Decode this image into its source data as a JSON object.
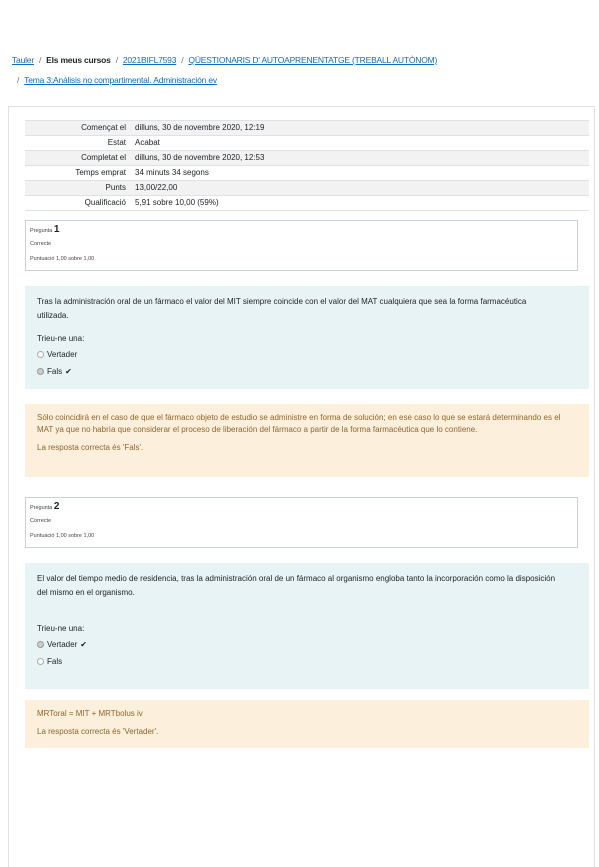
{
  "breadcrumb": {
    "items": [
      "Tauler",
      "Els meus cursos",
      "2021BIFL7593",
      "QÜESTIONARIS D' AUTOAPRENENTATGE (TREBALL AUTÒNOM)",
      "Tema 3:Análisis no compartimental. Administración ev"
    ],
    "separator": "/"
  },
  "summary": [
    {
      "label": "Començat el",
      "value": "dilluns, 30 de novembre 2020, 12:19"
    },
    {
      "label": "Estat",
      "value": "Acabat"
    },
    {
      "label": "Completat el",
      "value": "dilluns, 30 de novembre 2020, 12:53"
    },
    {
      "label": "Temps emprat",
      "value": "34 minuts 34 segons"
    },
    {
      "label": "Punts",
      "value": "13,00/22,00"
    },
    {
      "label": "Qualificació",
      "value": "5,91 sobre 10,00 (59%)"
    }
  ],
  "questions": [
    {
      "label": "Pregunta",
      "number": "1",
      "state": "Correcte",
      "mark": "Puntuació 1,00 sobre 1,00",
      "text": "Tras la administración oral de un fármaco el valor del MIT siempre coincide con el valor del MAT cualquiera que sea la forma farmacéutica utilizada.",
      "prompt": "Trieu-ne una:",
      "options": [
        "Vertader",
        "Fals"
      ],
      "feedback": "Sólo coincidirá en el caso de que el fármaco objeto de estudio se administre en forma de solución; en ese caso lo que se estará determinando es el MAT ya que no habría que considerar el proceso de liberación del fármaco a partir de la forma farmacéutica que lo contiene.",
      "right_answer": "La resposta correcta és 'Fals'."
    },
    {
      "label": "Pregunta",
      "number": "2",
      "state": "Correcte",
      "mark": "Puntuació 1,00 sobre 1,00",
      "text": "El valor del tiempo medio de residencia, tras la administración oral de un fármaco al organismo engloba tanto la incorporación como la disposición del mismo en el organismo.",
      "prompt": "Trieu-ne una:",
      "options": [
        "Vertader",
        "Fals"
      ],
      "feedback": "MRToral = MIT + MRTbolus iv",
      "right_answer": "La resposta correcta és 'Vertader'."
    }
  ],
  "icons": {
    "check": "check-icon"
  }
}
